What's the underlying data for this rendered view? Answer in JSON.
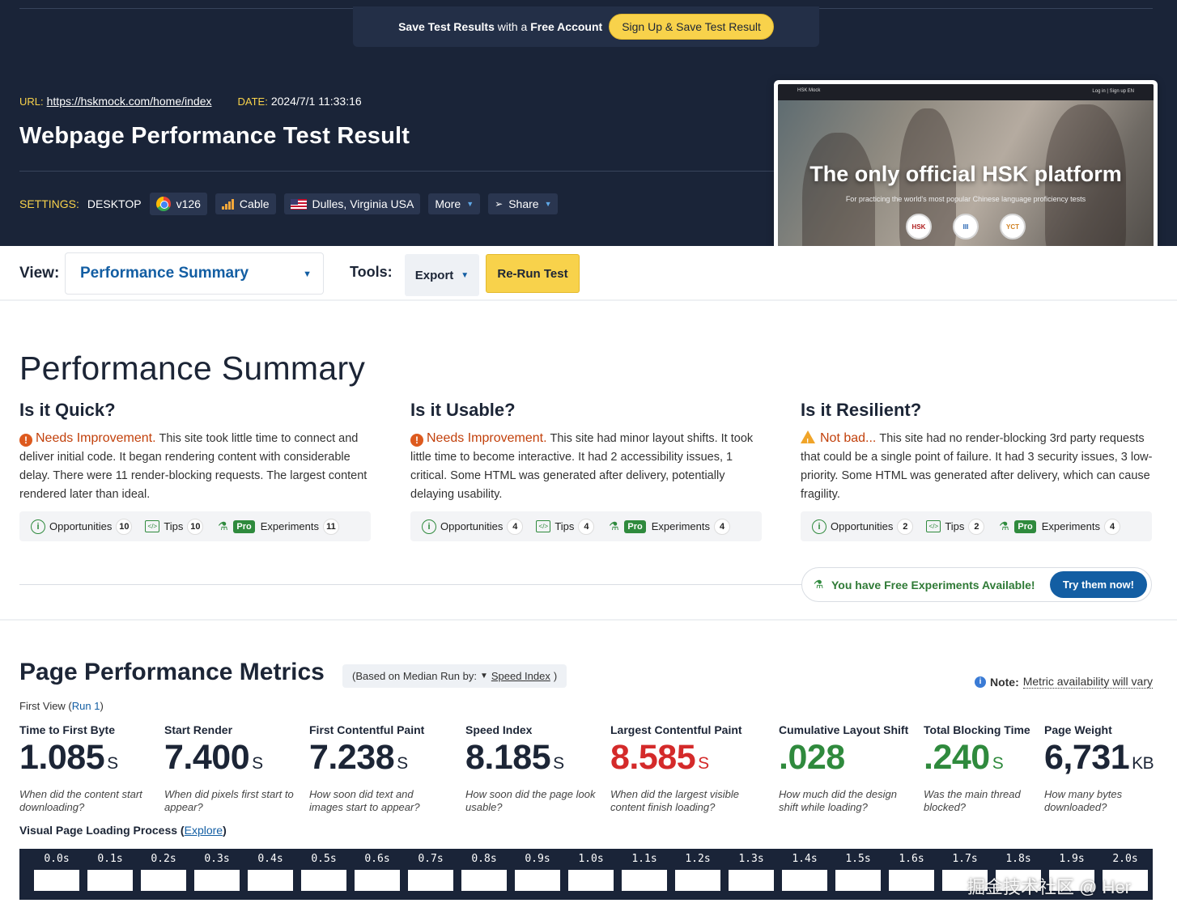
{
  "banner": {
    "text_bold_1": "Save Test Results",
    "text_mid": "with a",
    "text_bold_2": "Free Account",
    "signup_label": "Sign Up & Save Test Result"
  },
  "meta": {
    "url_label": "URL:",
    "url": "https://hskmock.com/home/index",
    "date_label": "DATE:",
    "date": "2024/7/1 11:33:16"
  },
  "title": "Webpage Performance Test Result",
  "settings": {
    "label": "SETTINGS:",
    "device": "DESKTOP",
    "browser": "v126",
    "connection": "Cable",
    "location": "Dulles, Virginia USA",
    "more": "More",
    "share": "Share"
  },
  "screenshot": {
    "nav_brand": "HSK Mock",
    "nav_right": "Log in | Sign up     EN",
    "headline": "The only official HSK platform",
    "sub": "For practicing the world's most popular Chinese language proficiency tests",
    "logos": [
      "HSK",
      "III",
      "YCT"
    ]
  },
  "toolbar": {
    "view_label": "View:",
    "view_value": "Performance Summary",
    "tools_label": "Tools:",
    "export": "Export",
    "rerun": "Re-Run Test"
  },
  "summary": {
    "title": "Performance Summary",
    "columns": [
      {
        "heading": "Is it Quick?",
        "status": "Needs Improvement.",
        "text": "This site took little time to connect and deliver initial code. It began rendering content with considerable delay. There were 11 render-blocking requests. The largest content rendered later than ideal.",
        "opportunities": "10",
        "tips": "10",
        "experiments": "11"
      },
      {
        "heading": "Is it Usable?",
        "status": "Needs Improvement.",
        "text": "This site had minor layout shifts. It took little time to become interactive. It had 2 accessibility issues, 1 critical. Some HTML was generated after delivery, potentially delaying usability.",
        "opportunities": "4",
        "tips": "4",
        "experiments": "4"
      },
      {
        "heading": "Is it Resilient?",
        "status": "Not bad...",
        "text": "This site had no render-blocking 3rd party requests that could be a single point of failure. It had 3 security issues, 3 low-priority. Some HTML was generated after delivery, which can cause fragility.",
        "opportunities": "2",
        "tips": "2",
        "experiments": "4"
      }
    ],
    "labels": {
      "opportunities": "Opportunities",
      "tips": "Tips",
      "pro": "Pro",
      "experiments": "Experiments"
    },
    "free_experiments": "You have Free Experiments Available!",
    "try_now": "Try them now!"
  },
  "metrics": {
    "title": "Page Performance Metrics",
    "median_prefix": "(Based on Median Run by:",
    "median_metric": "Speed Index",
    "median_suffix": ")",
    "note_label": "Note:",
    "note_text": "Metric availability will vary",
    "first_view": "First View (",
    "run": "Run 1",
    "first_view_close": ")",
    "items": [
      {
        "label": "Time to First Byte",
        "value": "1.085",
        "unit": "S",
        "desc": "When did the content start downloading?"
      },
      {
        "label": "Start Render",
        "value": "7.400",
        "unit": "S",
        "desc": "When did pixels first start to appear?"
      },
      {
        "label": "First Contentful Paint",
        "value": "7.238",
        "unit": "S",
        "desc": "How soon did text and images start to appear?"
      },
      {
        "label": "Speed Index",
        "value": "8.185",
        "unit": "S",
        "desc": "How soon did the page look usable?"
      },
      {
        "label": "Largest Contentful Paint",
        "value": "8.585",
        "unit": "S",
        "desc": "When did the largest visible content finish loading?"
      },
      {
        "label": "Cumulative Layout Shift",
        "value": ".028",
        "unit": "",
        "desc": "How much did the design shift while loading?"
      },
      {
        "label": "Total Blocking Time",
        "value": ".240",
        "unit": "S",
        "desc": "Was the main thread blocked?"
      },
      {
        "label": "Page Weight",
        "value": "6,731",
        "unit": "KB",
        "desc": "How many bytes downloaded?"
      }
    ],
    "visual_label": "Visual Page Loading Process",
    "explore": "Explore",
    "frames": [
      "0.0s",
      "0.1s",
      "0.2s",
      "0.3s",
      "0.4s",
      "0.5s",
      "0.6s",
      "0.7s",
      "0.8s",
      "0.9s",
      "1.0s",
      "1.1s",
      "1.2s",
      "1.3s",
      "1.4s",
      "1.5s",
      "1.6s",
      "1.7s",
      "1.8s",
      "1.9s",
      "2.0s"
    ]
  },
  "colors": {
    "navy": "#1a2438",
    "yellow": "#f8d24b",
    "blue": "#135ea3",
    "green": "#2f8a3d",
    "red": "#d42a2a",
    "orange": "#dd5a1e"
  },
  "watermark": "掘金技术社区 @ Her"
}
